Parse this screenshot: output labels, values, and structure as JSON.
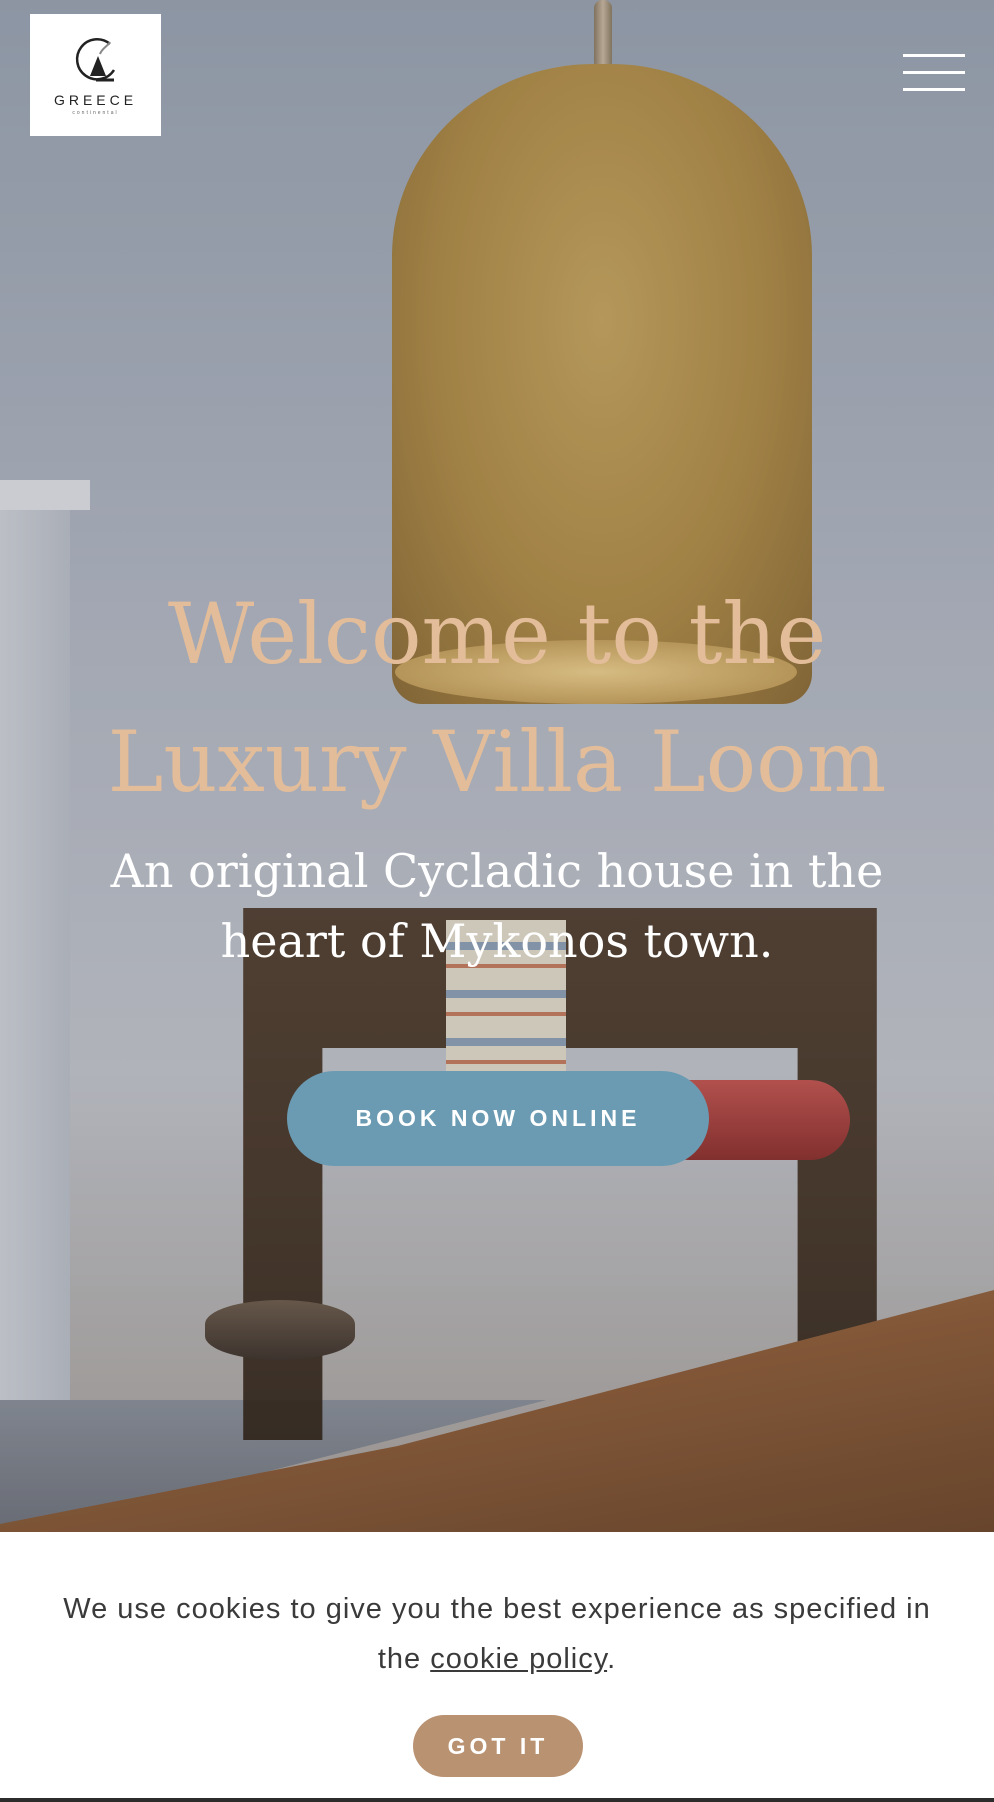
{
  "header": {
    "logo": {
      "word": "GREECE",
      "sub": "continental",
      "icon": "greece-logo-icon"
    },
    "menu": {
      "icon": "hamburger-menu-icon"
    }
  },
  "hero": {
    "title_line1": "Welcome to the",
    "title_line2": "Luxury Villa Loom",
    "subtitle_line1": "An original Cycladic house in the",
    "subtitle_line2": "heart of Mykonos town.",
    "cta_label": "BOOK NOW ONLINE"
  },
  "cookie_banner": {
    "text_before": "We use cookies to give you the best experience as specified in the ",
    "link_label": "cookie policy",
    "text_after": ".",
    "button_label": "GOT IT"
  },
  "colors": {
    "headline": "#e3bd9a",
    "cta_background": "#6b9bb2",
    "cookie_button": "#b99272"
  }
}
